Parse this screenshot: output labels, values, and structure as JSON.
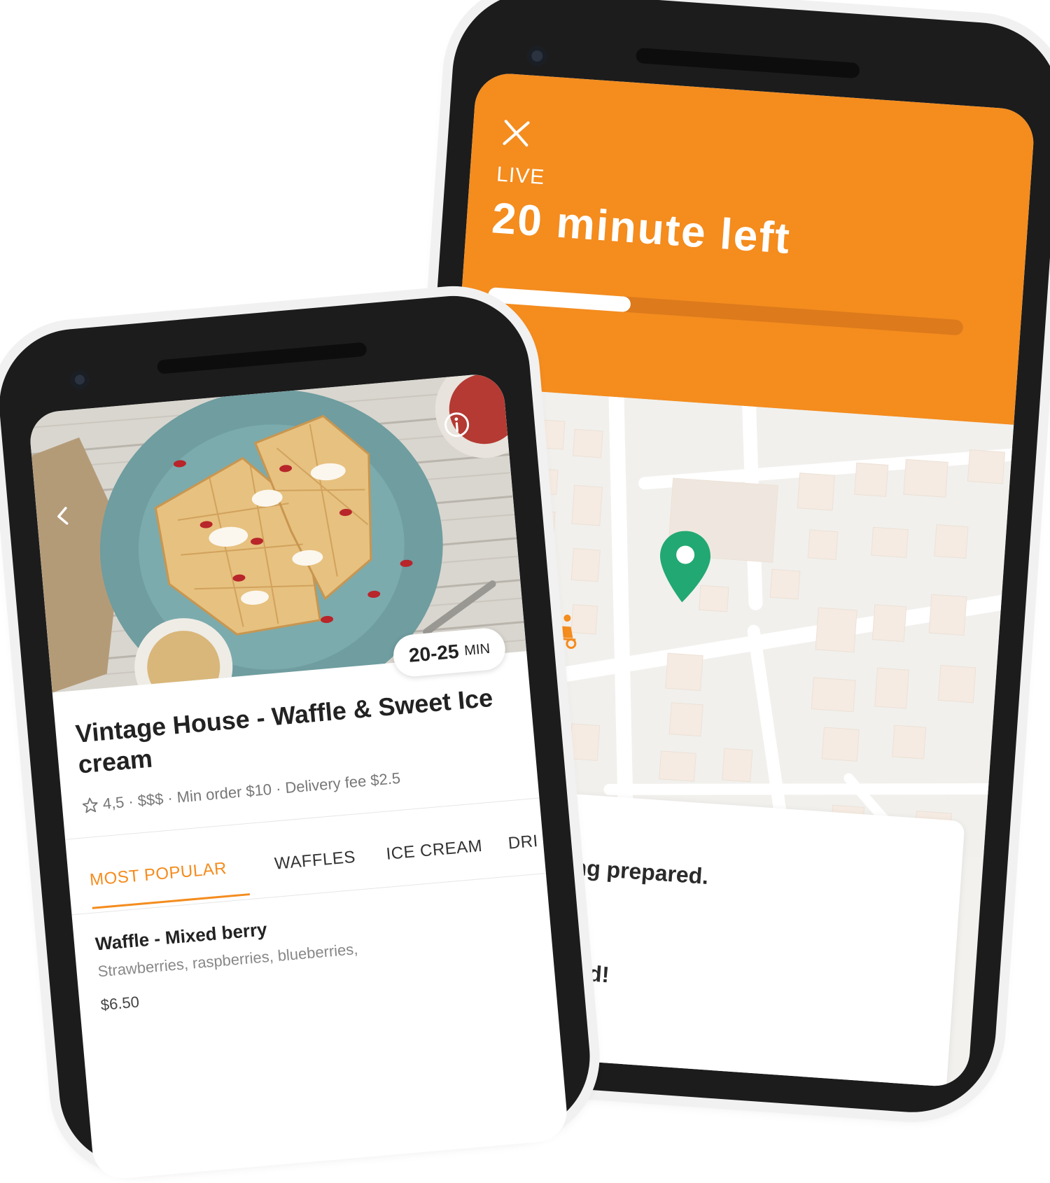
{
  "tracking": {
    "live_label": "LIVE",
    "time_left": "20 minute left",
    "progress_fraction": 0.3,
    "status_lines": [
      "being prepared.",
      "firmed!"
    ],
    "accent_color": "#f48c1e",
    "pin_color": "#22a872",
    "icons": [
      "close-icon",
      "location-pin-icon",
      "delivery-scooter-icon"
    ]
  },
  "restaurant": {
    "name": "Vintage House - Waffle & Sweet Ice cream",
    "rating": "4,5",
    "meta": "· $$$ · Min order $10 · Delivery fee $2.5",
    "eta_value": "20-25",
    "eta_unit": "MIN",
    "tabs": [
      "MOST POPULAR",
      "WAFFLES",
      "ICE CREAM",
      "DRI"
    ],
    "active_tab": 0,
    "item": {
      "name": "Waffle - Mixed berry",
      "description": "Strawberries, raspberries, blueberries,",
      "price": "$6.50"
    },
    "icons": [
      "back-chevron-icon",
      "info-icon",
      "star-icon"
    ]
  }
}
